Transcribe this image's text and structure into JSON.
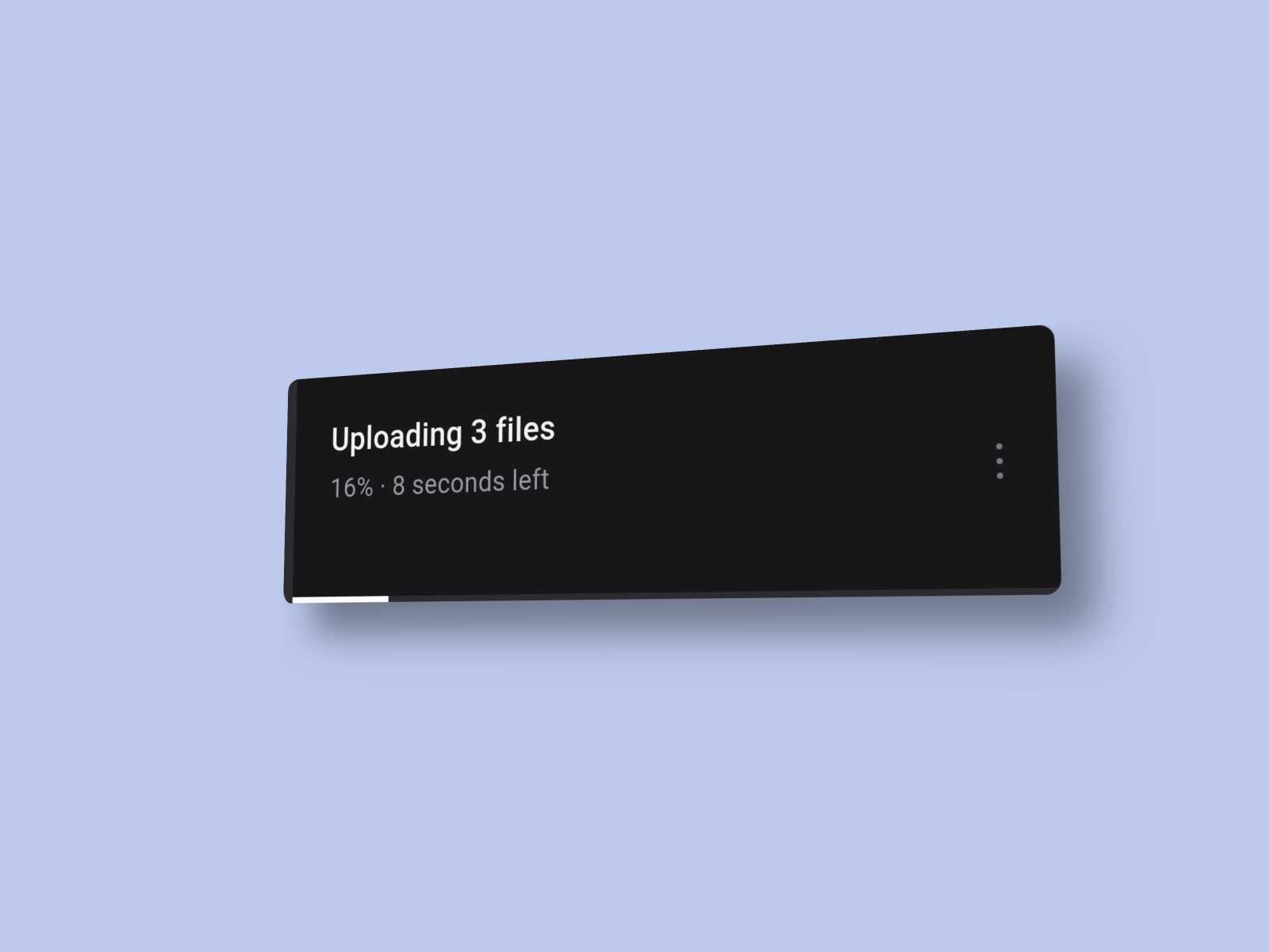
{
  "upload": {
    "title": "Uploading 3 files",
    "status": "16% · 8  seconds left",
    "progress_percent": 16
  },
  "colors": {
    "background": "#bcc9ed",
    "card": "#17171a",
    "track": "#2c2c30",
    "fill": "#ffffff",
    "title": "#f2f2f2",
    "subtitle": "#9a9a9e"
  }
}
